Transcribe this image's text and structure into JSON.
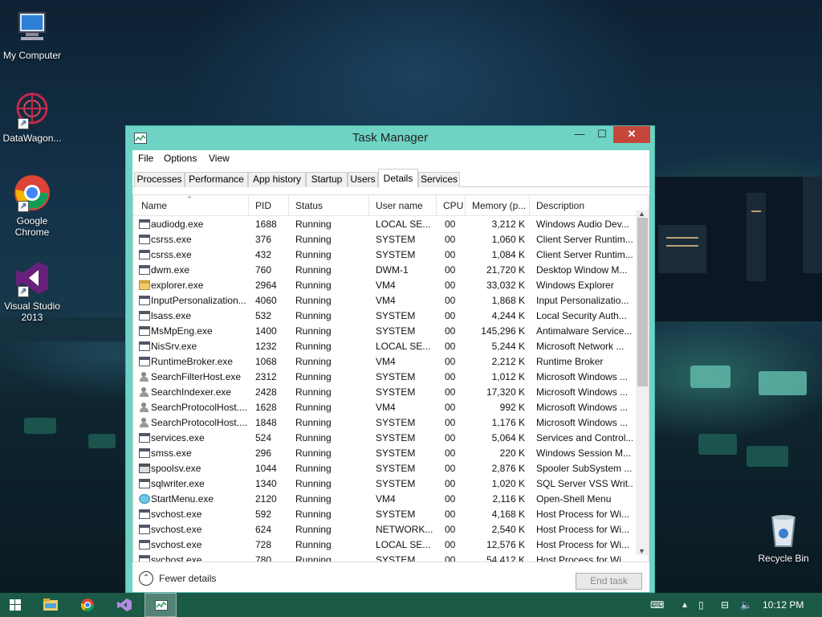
{
  "desktop": {
    "icons": [
      {
        "label": "My Computer",
        "icon": "computer-icon"
      },
      {
        "label": "DataWagon...",
        "icon": "datawagon-icon"
      },
      {
        "label": "Google Chrome",
        "icon": "chrome-icon"
      },
      {
        "label": "Visual Studio 2013",
        "icon": "visual-studio-icon"
      },
      {
        "label": "Recycle Bin",
        "icon": "recycle-bin-icon"
      }
    ]
  },
  "window": {
    "title": "Task Manager",
    "min": "—",
    "max": "☐",
    "close": "✕",
    "menu": [
      "File",
      "Options",
      "View"
    ],
    "tabs": [
      {
        "label": "Processes"
      },
      {
        "label": "Performance"
      },
      {
        "label": "App history"
      },
      {
        "label": "Startup"
      },
      {
        "label": "Users"
      },
      {
        "label": "Details",
        "active": true
      },
      {
        "label": "Services"
      }
    ],
    "columns": [
      "Name",
      "PID",
      "Status",
      "User name",
      "CPU",
      "Memory (p...",
      "Description"
    ],
    "rows": [
      [
        "audiodg.exe",
        "1688",
        "Running",
        "LOCAL SE...",
        "00",
        "3,212 K",
        "Windows Audio Dev..."
      ],
      [
        "csrss.exe",
        "376",
        "Running",
        "SYSTEM",
        "00",
        "1,060 K",
        "Client Server Runtim..."
      ],
      [
        "csrss.exe",
        "432",
        "Running",
        "SYSTEM",
        "00",
        "1,084 K",
        "Client Server Runtim..."
      ],
      [
        "dwm.exe",
        "760",
        "Running",
        "DWM-1",
        "00",
        "21,720 K",
        "Desktop Window M..."
      ],
      [
        "explorer.exe",
        "2964",
        "Running",
        "VM4",
        "00",
        "33,032 K",
        "Windows Explorer"
      ],
      [
        "InputPersonalization...",
        "4060",
        "Running",
        "VM4",
        "00",
        "1,868 K",
        "Input Personalizatio..."
      ],
      [
        "lsass.exe",
        "532",
        "Running",
        "SYSTEM",
        "00",
        "4,244 K",
        "Local Security Auth..."
      ],
      [
        "MsMpEng.exe",
        "1400",
        "Running",
        "SYSTEM",
        "00",
        "145,296 K",
        "Antimalware Service..."
      ],
      [
        "NisSrv.exe",
        "1232",
        "Running",
        "LOCAL SE...",
        "00",
        "5,244 K",
        "Microsoft Network ..."
      ],
      [
        "RuntimeBroker.exe",
        "1068",
        "Running",
        "VM4",
        "00",
        "2,212 K",
        "Runtime Broker"
      ],
      [
        "SearchFilterHost.exe",
        "2312",
        "Running",
        "SYSTEM",
        "00",
        "1,012 K",
        "Microsoft Windows ..."
      ],
      [
        "SearchIndexer.exe",
        "2428",
        "Running",
        "SYSTEM",
        "00",
        "17,320 K",
        "Microsoft Windows ..."
      ],
      [
        "SearchProtocolHost....",
        "1628",
        "Running",
        "VM4",
        "00",
        "992 K",
        "Microsoft Windows ..."
      ],
      [
        "SearchProtocolHost....",
        "1848",
        "Running",
        "SYSTEM",
        "00",
        "1,176 K",
        "Microsoft Windows ..."
      ],
      [
        "services.exe",
        "524",
        "Running",
        "SYSTEM",
        "00",
        "5,064 K",
        "Services and Control..."
      ],
      [
        "smss.exe",
        "296",
        "Running",
        "SYSTEM",
        "00",
        "220 K",
        "Windows Session M..."
      ],
      [
        "spoolsv.exe",
        "1044",
        "Running",
        "SYSTEM",
        "00",
        "2,876 K",
        "Spooler SubSystem ..."
      ],
      [
        "sqlwriter.exe",
        "1340",
        "Running",
        "SYSTEM",
        "00",
        "1,020 K",
        "SQL Server VSS Writ..."
      ],
      [
        "StartMenu.exe",
        "2120",
        "Running",
        "VM4",
        "00",
        "2,116 K",
        "Open-Shell Menu"
      ],
      [
        "svchost.exe",
        "592",
        "Running",
        "SYSTEM",
        "00",
        "4,168 K",
        "Host Process for Wi..."
      ],
      [
        "svchost.exe",
        "624",
        "Running",
        "NETWORK...",
        "00",
        "2,540 K",
        "Host Process for Wi..."
      ],
      [
        "svchost.exe",
        "728",
        "Running",
        "LOCAL SE...",
        "00",
        "12,576 K",
        "Host Process for Wi..."
      ],
      [
        "svchost.exe",
        "780",
        "Running",
        "SYSTEM",
        "00",
        "54,412 K",
        "Host Process for Wi..."
      ]
    ],
    "row_icons": [
      "app",
      "app",
      "app",
      "app",
      "folder",
      "app",
      "app",
      "app",
      "app",
      "app",
      "user",
      "user",
      "user",
      "user",
      "app",
      "app",
      "printer",
      "app",
      "globe",
      "app",
      "app",
      "app",
      "app"
    ],
    "fewer_details": "Fewer details",
    "end_task": "End task"
  },
  "taskbar": {
    "clock": "10:12 PM"
  }
}
